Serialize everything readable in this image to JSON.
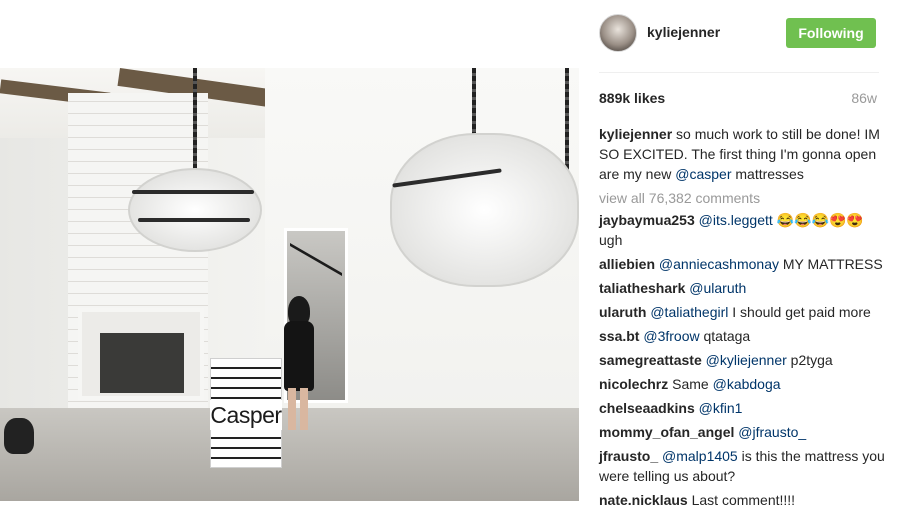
{
  "photo": {
    "box_brand": "Casper"
  },
  "header": {
    "username": "kyliejenner",
    "follow_button": "Following"
  },
  "stats": {
    "likes": "889k likes",
    "age": "86w"
  },
  "caption": {
    "user": "kyliejenner",
    "text_before": "so much work to still be done! IM SO EXCITED. The first thing I'm gonna open are my new",
    "mention": "@casper",
    "text_after": "mattresses"
  },
  "view_all": "view all 76,382 comments",
  "comments": [
    {
      "user": "jaybaymua253",
      "mention": "@its.leggett",
      "text": "😂😂😂😍😍 ugh"
    },
    {
      "user": "alliebien",
      "mention": "@anniecashmonay",
      "text": "MY MATTRESS"
    },
    {
      "user": "taliatheshark",
      "mention": "@ularuth",
      "text": ""
    },
    {
      "user": "ularuth",
      "mention": "@taliathegirl",
      "text": "I should get paid more"
    },
    {
      "user": "ssa.bt",
      "mention": "@3froow",
      "text": "qtataga"
    },
    {
      "user": "samegreattaste",
      "mention": "@kyliejenner",
      "text": "p2tyga"
    },
    {
      "user": "nicolechrz",
      "mention": "",
      "text": "Same",
      "mention_after": "@kabdoga"
    },
    {
      "user": "chelseaadkins",
      "mention": "@kfin1",
      "text": ""
    },
    {
      "user": "mommy_ofan_angel",
      "mention": "@jfrausto_",
      "text": ""
    },
    {
      "user": "jfrausto_",
      "mention": "@malp1405",
      "text": "is this the mattress you were telling us about?"
    },
    {
      "user": "nate.nicklaus",
      "mention": "",
      "text": "Last comment!!!!"
    }
  ]
}
